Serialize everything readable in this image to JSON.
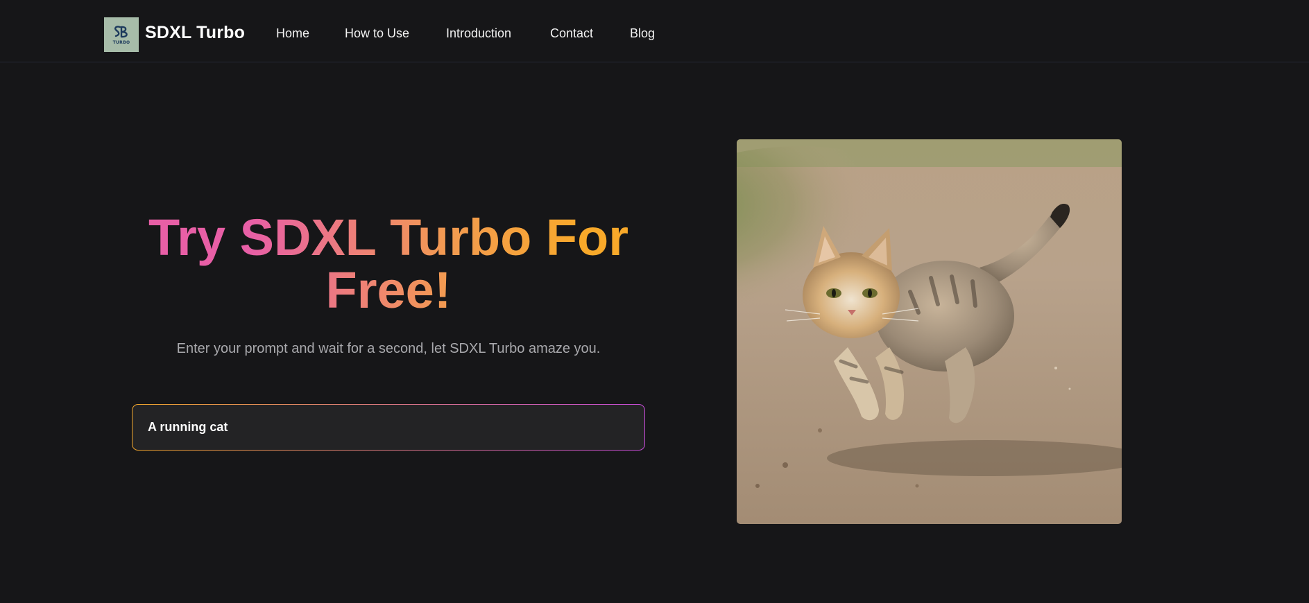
{
  "header": {
    "logo": {
      "mark": "SB",
      "sub": "TURBO"
    },
    "brand": "SDXL Turbo",
    "nav": [
      {
        "label": "Home"
      },
      {
        "label": "How to Use"
      },
      {
        "label": "Introduction"
      },
      {
        "label": "Contact"
      },
      {
        "label": "Blog"
      }
    ]
  },
  "hero": {
    "title_line1": "Try SDXL Turbo For",
    "title_line2": "Free!",
    "subtitle": "Enter your prompt and wait for a second, let SDXL Turbo amaze you.",
    "prompt_value": "A running cat"
  },
  "image": {
    "subject": "running-cat-photo"
  },
  "colors": {
    "background": "#161618",
    "gradient_start": "#e85fa6",
    "gradient_end": "#f8a92a",
    "input_border_start": "#f0a52b",
    "input_border_end": "#c64bd8"
  }
}
